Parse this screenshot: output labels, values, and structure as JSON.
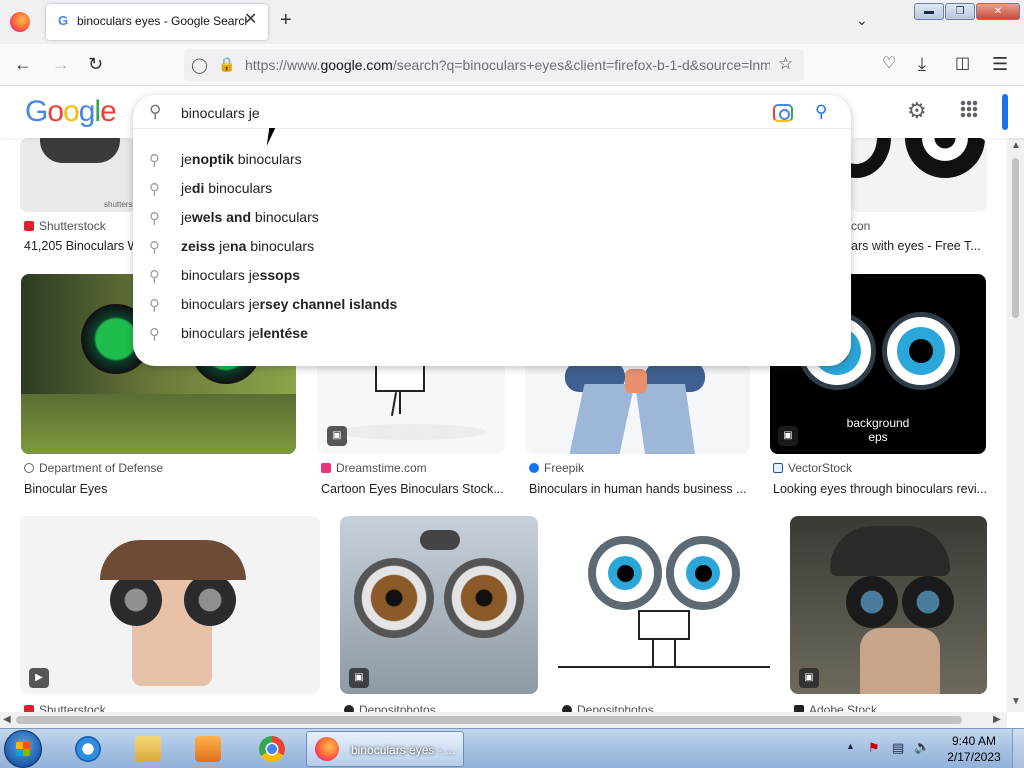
{
  "browser": {
    "tab_title": "binoculars eyes - Google Search",
    "tab_close": "✕",
    "new_tab": "+",
    "url_domain": "google.com",
    "url_prefix": "https://www.",
    "url_rest": "/search?q=binoculars+eyes&client=firefox-b-1-d&source=lnms"
  },
  "google": {
    "logo_letters": [
      "G",
      "o",
      "o",
      "g",
      "l",
      "e"
    ],
    "query": "binoculars je",
    "suggestions": [
      {
        "pre": "je",
        "bold": "noptik",
        "post": " binoculars"
      },
      {
        "pre": "je",
        "bold": "di",
        "post": " binoculars"
      },
      {
        "pre": "je",
        "bold": "wels and",
        "post": " binoculars"
      },
      {
        "pre": "",
        "bold": "zeiss",
        "post": " jena binoculars",
        "mid": [
          "je",
          "na"
        ]
      },
      {
        "pre": "binoculars je",
        "bold": "ssops",
        "post": ""
      },
      {
        "pre": "binoculars je",
        "bold": "rsey channel islands",
        "post": ""
      },
      {
        "pre": "binoculars je",
        "bold": "lentése",
        "post": ""
      }
    ]
  },
  "results": {
    "row0": [
      {
        "source": "Shutterstock",
        "caption": "41,205 Binoculars W"
      },
      {
        "source": "con",
        "caption": "ars with eyes - Free T..."
      }
    ],
    "row1": [
      {
        "source": "Department of Defense",
        "caption": "Binocular Eyes"
      },
      {
        "source": "Dreamstime.com",
        "caption": "Cartoon Eyes Binoculars Stock..."
      },
      {
        "source": "Freepik",
        "caption": "Binoculars in human hands business ..."
      },
      {
        "source": "VectorStock",
        "caption": "Looking eyes through binoculars revi..."
      }
    ],
    "row2": [
      {
        "source": "Shutterstock"
      },
      {
        "source": "Depositphotos"
      },
      {
        "source": "Depositphotos"
      },
      {
        "source": "Adobe Stock"
      }
    ],
    "vectorstock_overlay": {
      "line1": "background",
      "line2": "eps"
    },
    "row0_watermark": "shutters"
  },
  "taskbar": {
    "active_label": "binoculars eyes - ...",
    "time": "9:40 AM",
    "date": "2/17/2023"
  },
  "colors": {
    "accent_blue": "#1a73e8",
    "taskbar": "#a6c1e2"
  }
}
